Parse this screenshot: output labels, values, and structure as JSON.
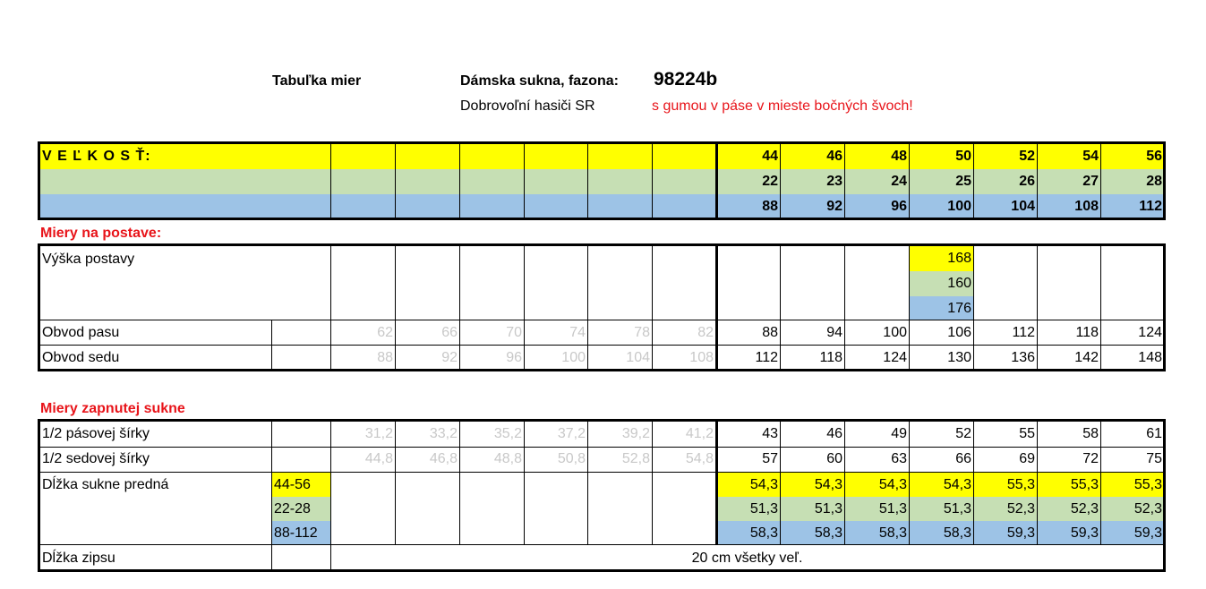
{
  "header": {
    "table_title": "Tabuľka mier",
    "product_label": "Dámska sukna, fazona:",
    "product_code": "98224b",
    "customer": "Dobrovoľní hasiči SR",
    "note": "s gumou v páse v mieste bočných švoch!"
  },
  "size_table": {
    "label": "V E Ľ K O S Ť:",
    "row_yellow": [
      "44",
      "46",
      "48",
      "50",
      "52",
      "54",
      "56"
    ],
    "row_green": [
      "22",
      "23",
      "24",
      "25",
      "26",
      "27",
      "28"
    ],
    "row_blue": [
      "88",
      "92",
      "96",
      "100",
      "104",
      "108",
      "112"
    ]
  },
  "body_section": {
    "title": "Miery na postave:",
    "height_label": "Výška postavy",
    "heights": [
      "168",
      "160",
      "176"
    ],
    "waist_label": "Obvod pasu",
    "waist_grey": [
      "62",
      "66",
      "70",
      "74",
      "78",
      "82"
    ],
    "waist": [
      "88",
      "94",
      "100",
      "106",
      "112",
      "118",
      "124"
    ],
    "hip_label": "Obvod sedu",
    "hip_grey": [
      "88",
      "92",
      "96",
      "100",
      "104",
      "108"
    ],
    "hip": [
      "112",
      "118",
      "124",
      "130",
      "136",
      "142",
      "148"
    ]
  },
  "skirt_section": {
    "title": "Miery zapnutej sukne",
    "half_waist_label": "1/2 pásovej šírky",
    "half_waist_grey": [
      "31,2",
      "33,2",
      "35,2",
      "37,2",
      "39,2",
      "41,2"
    ],
    "half_waist": [
      "43",
      "46",
      "49",
      "52",
      "55",
      "58",
      "61"
    ],
    "half_hip_label": "1/2 sedovej šírky",
    "half_hip_grey": [
      "44,8",
      "46,8",
      "48,8",
      "50,8",
      "52,8",
      "54,8"
    ],
    "half_hip": [
      "57",
      "60",
      "63",
      "66",
      "69",
      "72",
      "75"
    ],
    "length_label": "Dĺžka sukne predná",
    "range_yellow": "44-56",
    "range_green": "22-28",
    "range_blue": "88-112",
    "length_yellow": [
      "54,3",
      "54,3",
      "54,3",
      "54,3",
      "55,3",
      "55,3",
      "55,3"
    ],
    "length_green": [
      "51,3",
      "51,3",
      "51,3",
      "51,3",
      "52,3",
      "52,3",
      "52,3"
    ],
    "length_blue": [
      "58,3",
      "58,3",
      "58,3",
      "58,3",
      "59,3",
      "59,3",
      "59,3"
    ],
    "zip_label": "Dĺžka zipsu",
    "zip_value": "20 cm všetky veľ."
  }
}
